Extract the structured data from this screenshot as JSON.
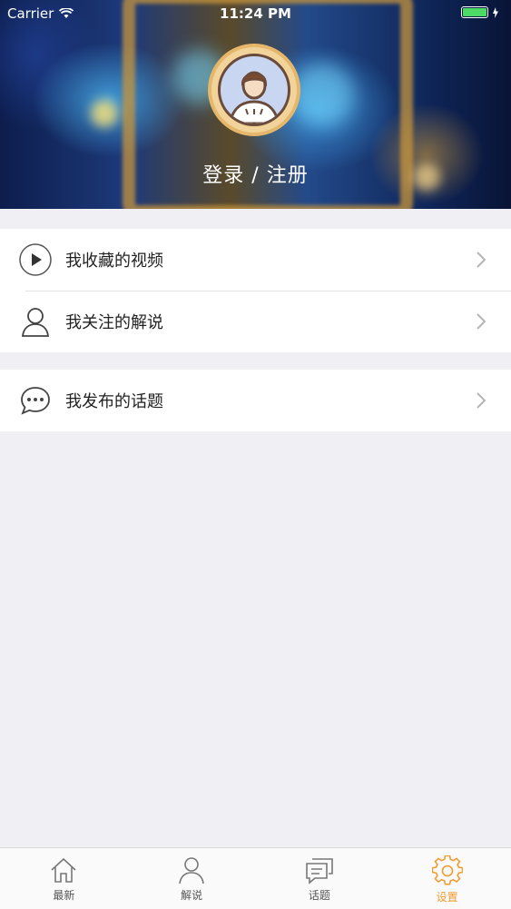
{
  "status_bar": {
    "carrier": "Carrier",
    "time": "11:24 PM",
    "wifi_icon": "wifi-icon",
    "battery_color": "#4cd964"
  },
  "header": {
    "avatar_icon": "user-avatar-icon",
    "login_text": "登录 / 注册"
  },
  "menu": {
    "group1": [
      {
        "label": "我收藏的视频",
        "icon": "play-circle-icon"
      },
      {
        "label": "我关注的解说",
        "icon": "person-icon"
      }
    ],
    "group2": [
      {
        "label": "我发布的话题",
        "icon": "chat-bubble-icon"
      }
    ]
  },
  "tabbar": {
    "accent_color": "#f29a2e",
    "items": [
      {
        "label": "最新",
        "icon": "home-icon",
        "active": false
      },
      {
        "label": "解说",
        "icon": "person-icon",
        "active": false
      },
      {
        "label": "话题",
        "icon": "chat-icon",
        "active": false
      },
      {
        "label": "设置",
        "icon": "gear-icon",
        "active": true
      }
    ]
  }
}
